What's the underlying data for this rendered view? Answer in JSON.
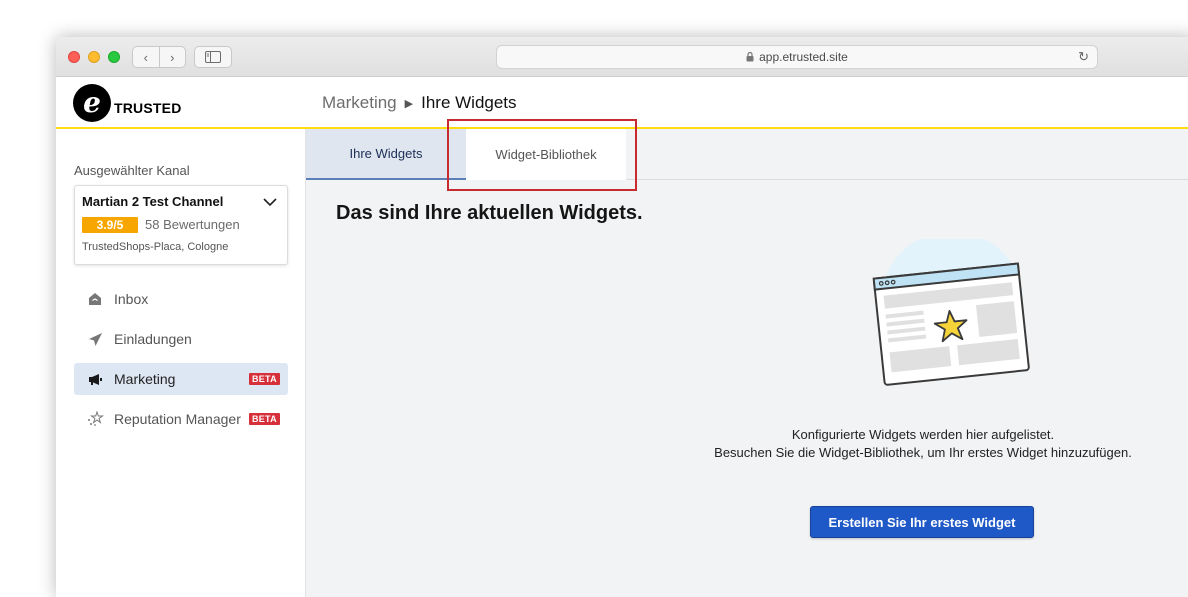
{
  "browser": {
    "url": "app.etrusted.site"
  },
  "header": {
    "logo_letter": "e",
    "logo_text": "TRUSTED",
    "breadcrumb": {
      "parent": "Marketing",
      "current": "Ihre Widgets"
    },
    "accent_color": "#ffdc0f"
  },
  "sidebar": {
    "channel_label": "Ausgewählter Kanal",
    "channel": {
      "name": "Martian 2 Test Channel",
      "rating": "3.9/5",
      "reviews": "58 Bewertungen",
      "location": "TrustedShops-Placa, Cologne",
      "rating_color": "#f7a600"
    },
    "items": [
      {
        "label": "Inbox",
        "icon": "inbox-icon",
        "active": false,
        "badge": ""
      },
      {
        "label": "Einladungen",
        "icon": "paper-plane-icon",
        "active": false,
        "badge": ""
      },
      {
        "label": "Marketing",
        "icon": "megaphone-icon",
        "active": true,
        "badge": "BETA"
      },
      {
        "label": "Reputation Manager",
        "icon": "sparkles-icon",
        "active": false,
        "badge": "BETA"
      }
    ]
  },
  "main": {
    "tabs": [
      {
        "label": "Ihre Widgets",
        "active": true
      },
      {
        "label": "Widget-Bibliothek",
        "active": false
      }
    ],
    "heading": "Das sind Ihre aktuellen Widgets.",
    "empty_line1": "Konfigurierte Widgets werden hier aufgelistet.",
    "empty_line2": "Besuchen Sie die Widget-Bibliothek, um Ihr erstes Widget hinzuzufügen.",
    "cta_label": "Erstellen Sie Ihr erstes Widget",
    "cta_color": "#1f59c7",
    "highlight_color": "#c72b2f"
  }
}
